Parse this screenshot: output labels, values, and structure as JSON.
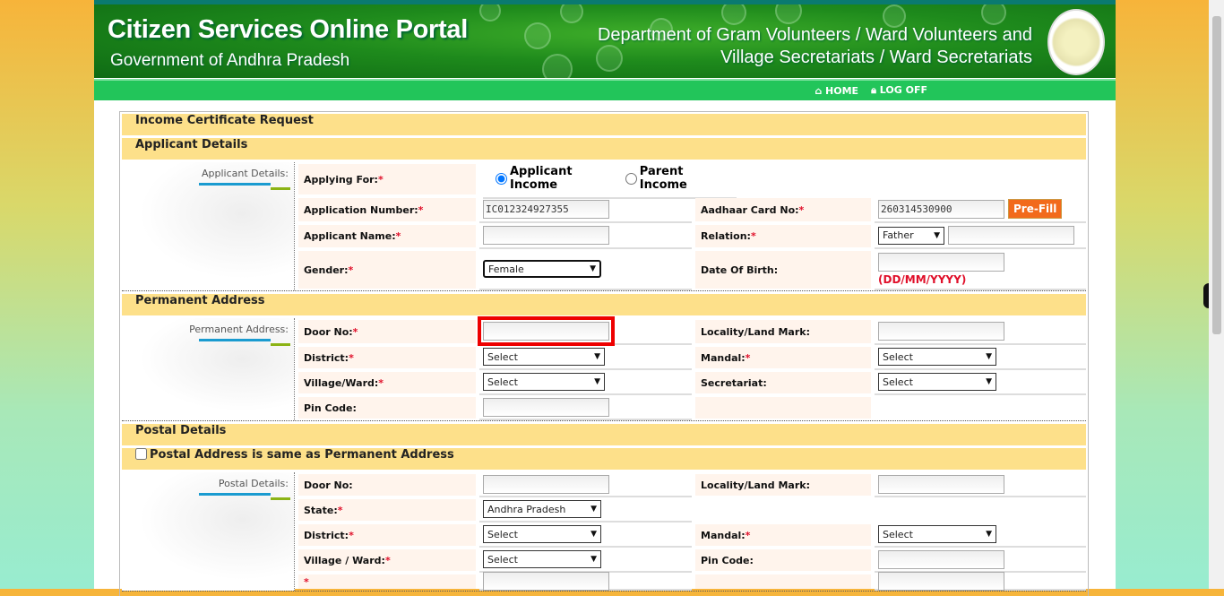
{
  "header": {
    "title": "Citizen Services Online Portal",
    "subtitle": "Government of Andhra Pradesh",
    "department_line1": "Department of Gram Volunteers / Ward Volunteers and",
    "department_line2": "Village Secretariats / Ward Secretariats",
    "logo": "andhra-pradesh-emblem"
  },
  "nav": {
    "home": "HOME",
    "logoff": "LOG OFF",
    "home_icon": "home-icon",
    "logoff_icon": "lock-icon"
  },
  "form": {
    "title": "Income Certificate Request",
    "sections": [
      {
        "header": "Applicant Details",
        "side_label": "Applicant Details:",
        "rows": [
          {
            "cells": [
              {
                "label": "Applying For:",
                "req": true
              },
              {
                "type": "radio",
                "options": [
                  "Applicant Income",
                  "Parent Income"
                ],
                "selected": 0,
                "span": 3
              }
            ]
          },
          {
            "cells": [
              {
                "label": "Application Number:",
                "req": true
              },
              {
                "type": "text",
                "value": "IC012324927355"
              },
              {
                "label": "Aadhaar Card No:",
                "req": true
              },
              {
                "type": "text",
                "value": "260314530900",
                "button": "Pre-Fill"
              }
            ]
          },
          {
            "cells": [
              {
                "label": "Applicant Name:",
                "req": true
              },
              {
                "type": "text",
                "value": ""
              },
              {
                "label": "Relation:",
                "req": true
              },
              {
                "type": "select",
                "value": "Father",
                "extra_text": true
              }
            ]
          },
          {
            "cells": [
              {
                "label": "Gender:",
                "req": true
              },
              {
                "type": "select",
                "value": "Female",
                "focused": true
              },
              {
                "label": "Date Of Birth:",
                "req": false
              },
              {
                "type": "text",
                "value": "",
                "hint": "(DD/MM/YYYY)"
              }
            ]
          }
        ]
      },
      {
        "header": "Permanent Address",
        "side_label": "Permanent Address:",
        "rows": [
          {
            "cells": [
              {
                "label": "Door No:",
                "req": true
              },
              {
                "type": "text",
                "value": "",
                "highlighted": true
              },
              {
                "label": "Locality/Land Mark:",
                "req": false
              },
              {
                "type": "text",
                "value": ""
              }
            ]
          },
          {
            "cells": [
              {
                "label": "District:",
                "req": true
              },
              {
                "type": "select",
                "value": "Select"
              },
              {
                "label": "Mandal:",
                "req": true
              },
              {
                "type": "select",
                "value": "Select"
              }
            ]
          },
          {
            "cells": [
              {
                "label": "Village/Ward:",
                "req": true
              },
              {
                "type": "select",
                "value": "Select"
              },
              {
                "label": "Secretariat:",
                "req": false
              },
              {
                "type": "select",
                "value": "Select"
              }
            ]
          },
          {
            "cells": [
              {
                "label": "Pin Code:",
                "req": false
              },
              {
                "type": "text",
                "value": ""
              },
              {
                "label": "",
                "req": false
              },
              {
                "type": "empty"
              }
            ]
          }
        ]
      },
      {
        "header": "Postal Details",
        "checkbox_header": "Postal Address is same as Permanent Address",
        "checkbox_checked": false,
        "side_label": "Postal Details:",
        "rows": [
          {
            "cells": [
              {
                "label": "Door No:",
                "req": false
              },
              {
                "type": "text",
                "value": ""
              },
              {
                "label": "Locality/Land Mark:",
                "req": false
              },
              {
                "type": "text",
                "value": ""
              }
            ]
          },
          {
            "cells": [
              {
                "label": "State:",
                "req": true
              },
              {
                "type": "select",
                "value": "Andhra Pradesh"
              },
              {
                "label": "",
                "req": false,
                "blank": true
              },
              {
                "type": "empty"
              }
            ]
          },
          {
            "cells": [
              {
                "label": "District:",
                "req": true
              },
              {
                "type": "select",
                "value": "Select"
              },
              {
                "label": "Mandal:",
                "req": true
              },
              {
                "type": "select",
                "value": "Select"
              }
            ]
          },
          {
            "cells": [
              {
                "label": "Village / Ward:",
                "req": true
              },
              {
                "type": "select",
                "value": "Select"
              },
              {
                "label": "Pin Code:",
                "req": false
              },
              {
                "type": "text",
                "value": ""
              }
            ]
          },
          {
            "cells": [
              {
                "label": "",
                "req": true
              },
              {
                "type": "text",
                "value": ""
              },
              {
                "label": "",
                "req": false
              },
              {
                "type": "text",
                "value": ""
              }
            ]
          }
        ]
      }
    ]
  },
  "colors": {
    "header_green": "#1e8a1c",
    "nav_green": "#22c55a",
    "section_yellow": "#fde08a",
    "label_bg": "#fff4ec",
    "required": "#e0102a",
    "prefill": "#f26a1b",
    "highlight": "#ee0000"
  }
}
